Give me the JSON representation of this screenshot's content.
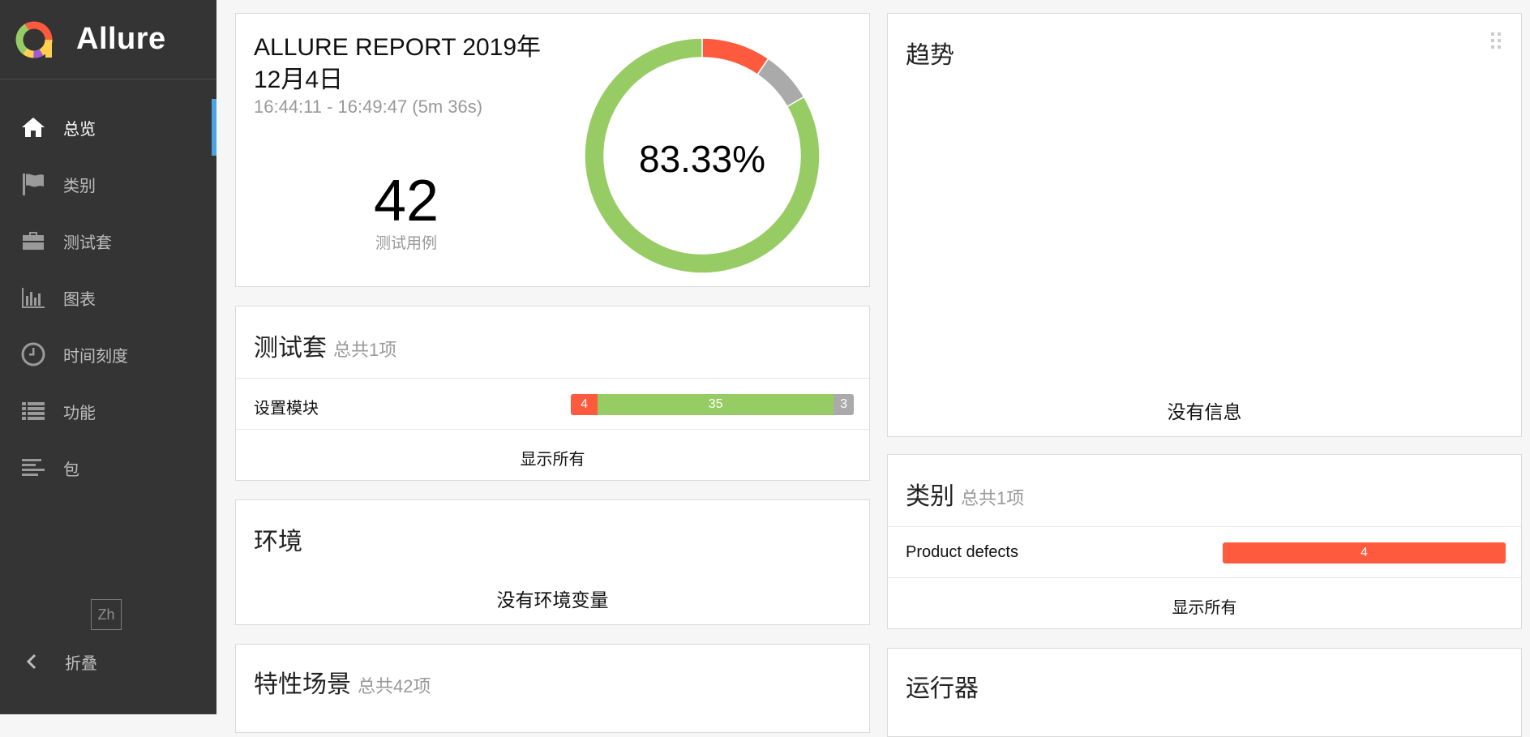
{
  "brand": {
    "name": "Allure"
  },
  "sidebar": {
    "items": [
      {
        "label": "总览",
        "icon": "home-icon",
        "active": true
      },
      {
        "label": "类别",
        "icon": "flag-icon",
        "active": false
      },
      {
        "label": "测试套",
        "icon": "briefcase-icon",
        "active": false
      },
      {
        "label": "图表",
        "icon": "bar-chart-icon",
        "active": false
      },
      {
        "label": "时间刻度",
        "icon": "clock-icon",
        "active": false
      },
      {
        "label": "功能",
        "icon": "list-icon",
        "active": false
      },
      {
        "label": "包",
        "icon": "align-left-icon",
        "active": false
      }
    ],
    "language": "Zh",
    "collapse_label": "折叠"
  },
  "summary": {
    "title": "ALLURE REPORT 2019年12月4日",
    "time_range": "16:44:11 - 16:49:47 (5m 36s)",
    "test_count": "42",
    "test_count_label": "测试用例",
    "success_rate": "83.33%"
  },
  "chart_data": {
    "type": "pie",
    "variant": "donut",
    "categories": [
      "passed",
      "failed",
      "skipped"
    ],
    "values": [
      35,
      4,
      3
    ],
    "colors": {
      "passed": "#97cc64",
      "failed": "#fd5a3e",
      "skipped": "#aaaaaa"
    },
    "center_label": "83.33%"
  },
  "suites": {
    "title": "测试套",
    "subtitle": "总共1项",
    "rows": [
      {
        "label": "设置模块",
        "failed": 4,
        "passed": 35,
        "skipped": 3
      }
    ],
    "show_all": "显示所有"
  },
  "environment": {
    "title": "环境",
    "empty": "没有环境变量"
  },
  "features": {
    "title": "特性场景",
    "subtitle": "总共42项"
  },
  "trend": {
    "title": "趋势",
    "empty": "没有信息"
  },
  "categories": {
    "title": "类别",
    "subtitle": "总共1项",
    "rows": [
      {
        "label": "Product defects",
        "failed": 4
      }
    ],
    "show_all": "显示所有"
  },
  "runner": {
    "title": "运行器"
  },
  "colors": {
    "failed": "#fd5a3e",
    "passed": "#97cc64",
    "skipped": "#aaaaaa",
    "sidebar_bg": "#343434",
    "active_marker": "#4ba3e0"
  }
}
